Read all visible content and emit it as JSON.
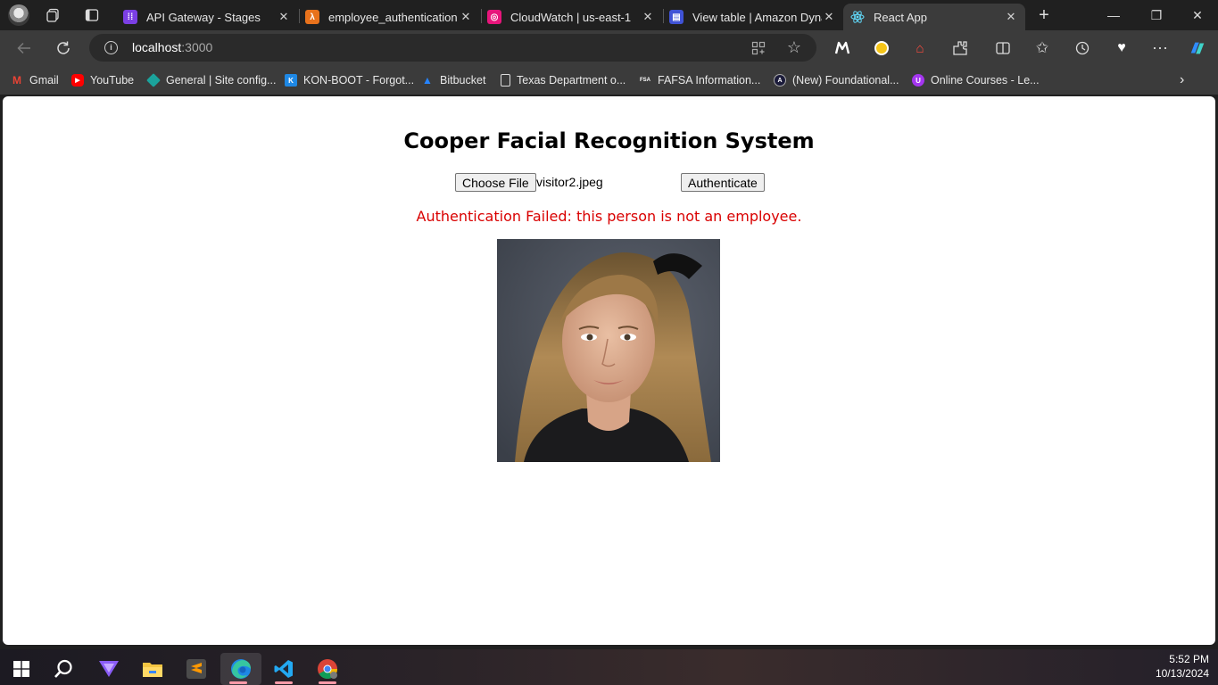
{
  "browser": {
    "tabs": [
      {
        "title": "API Gateway - Stages",
        "favicon": "api-gateway-icon",
        "color": "#7b3fe4"
      },
      {
        "title": "employee_authentication |",
        "favicon": "lambda-icon",
        "color": "#e8721c"
      },
      {
        "title": "CloudWatch | us-east-1",
        "favicon": "cloudwatch-icon",
        "color": "#e7157b"
      },
      {
        "title": "View table | Amazon Dynar",
        "favicon": "dynamodb-icon",
        "color": "#4053d6"
      },
      {
        "title": "React App",
        "favicon": "react-icon",
        "color": "#61dafb",
        "active": true
      }
    ],
    "address": {
      "host": "localhost",
      "port": ":3000"
    },
    "bookmarks": [
      {
        "label": "Gmail",
        "icon": "gmail-icon"
      },
      {
        "label": "YouTube",
        "icon": "youtube-icon"
      },
      {
        "label": "General | Site config...",
        "icon": "diamond-icon"
      },
      {
        "label": "KON-BOOT - Forgot...",
        "icon": "konboot-icon"
      },
      {
        "label": "Bitbucket",
        "icon": "bitbucket-icon"
      },
      {
        "label": "Texas Department o...",
        "icon": "page-icon"
      },
      {
        "label": "FAFSA Information...",
        "icon": "fsa-icon"
      },
      {
        "label": "(New) Foundational...",
        "icon": "foundational-icon"
      },
      {
        "label": "Online Courses - Le...",
        "icon": "udemy-icon"
      }
    ]
  },
  "app": {
    "title": "Cooper Facial Recognition System",
    "choose_file_label": "Choose File",
    "file_name": "visitor2.jpeg",
    "authenticate_label": "Authenticate",
    "status_message": "Authentication Failed: this person is not an employee.",
    "status_color": "#d90000"
  },
  "taskbar": {
    "time": "5:52 PM",
    "date": "10/13/2024"
  }
}
